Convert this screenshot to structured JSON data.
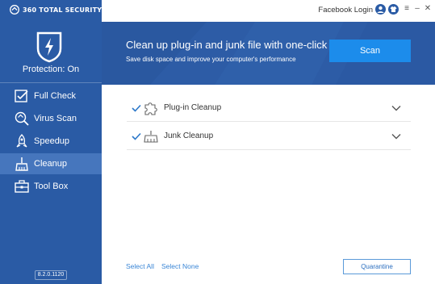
{
  "app": {
    "brand": "360 TOTAL SECURITY",
    "protection_status": "Protection: On",
    "version": "8.2.0.1120"
  },
  "topbar": {
    "facebook_login": "Facebook Login"
  },
  "sidebar": {
    "items": [
      {
        "label": "Full Check",
        "icon": "full-check-icon",
        "active": false
      },
      {
        "label": "Virus Scan",
        "icon": "virus-scan-icon",
        "active": false
      },
      {
        "label": "Speedup",
        "icon": "speedup-icon",
        "active": false
      },
      {
        "label": "Cleanup",
        "icon": "cleanup-icon",
        "active": true
      },
      {
        "label": "Tool Box",
        "icon": "toolbox-icon",
        "active": false
      }
    ]
  },
  "banner": {
    "title": "Clean up plug-in and junk file with one-click",
    "subtitle": "Save disk space and improve your computer's performance",
    "scan_label": "Scan"
  },
  "cleanup_items": [
    {
      "label": "Plug-in Cleanup",
      "checked": true,
      "icon": "puzzle-icon"
    },
    {
      "label": "Junk Cleanup",
      "checked": true,
      "icon": "broom-icon"
    }
  ],
  "footer": {
    "select_all": "Select All",
    "select_none": "Select None",
    "quarantine": "Quarantine"
  },
  "colors": {
    "sidebar": "#2a5ba5",
    "sidebar_active": "#4676bd",
    "banner": "#2d5ca6",
    "scan_button": "#1c8ceb",
    "link": "#3a86d6"
  }
}
